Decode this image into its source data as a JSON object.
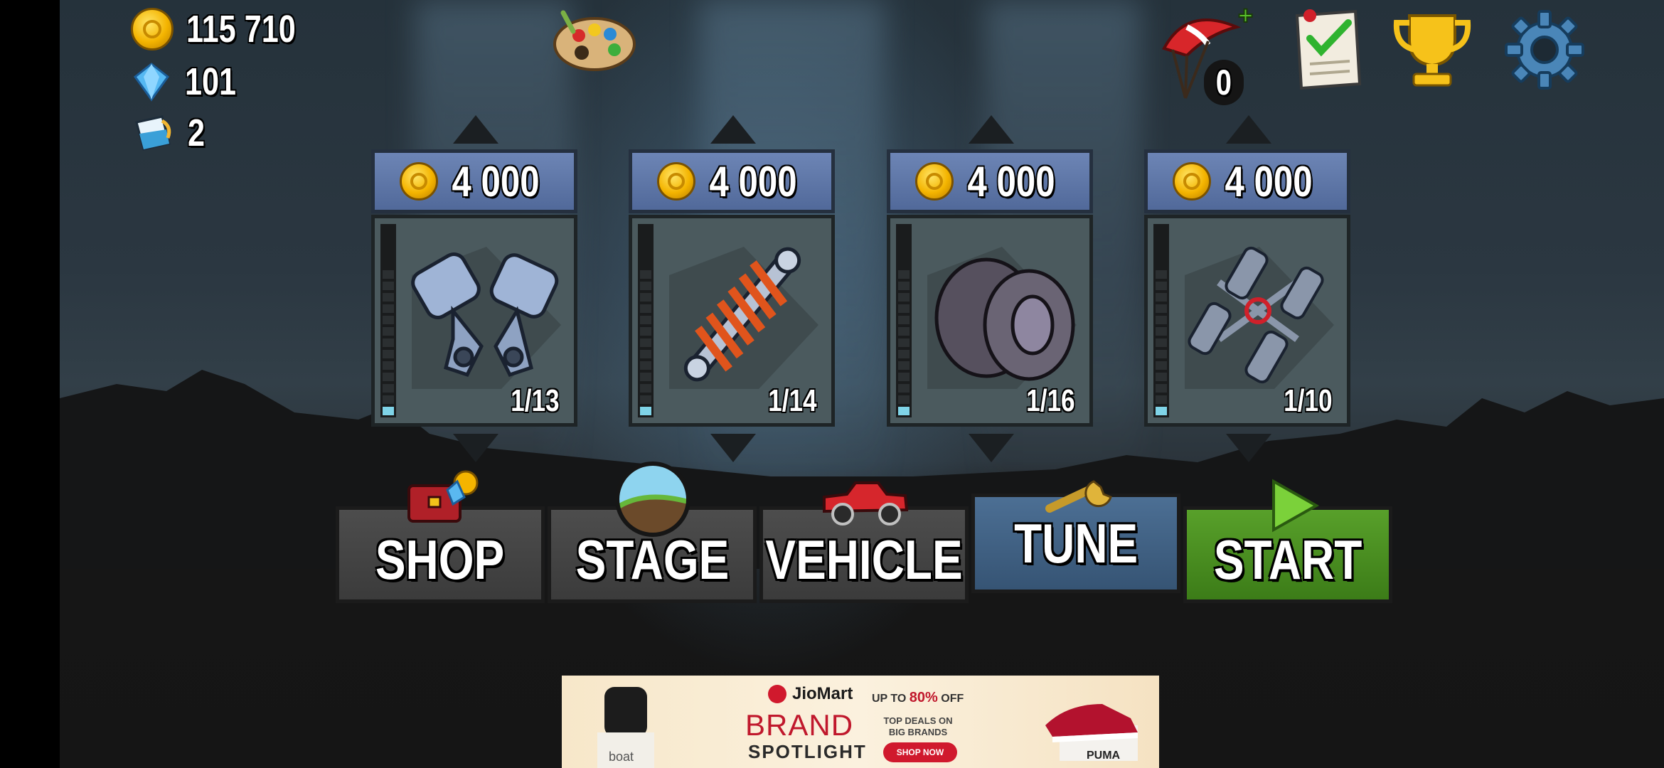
{
  "currency": {
    "coins": "115 710",
    "gems": "101",
    "paint": "2"
  },
  "top_right": {
    "parachute_count": "0"
  },
  "upgrades": [
    {
      "name": "engine",
      "price": "4 000",
      "level": "1/13"
    },
    {
      "name": "suspension",
      "price": "4 000",
      "level": "1/14"
    },
    {
      "name": "tires",
      "price": "4 000",
      "level": "1/16"
    },
    {
      "name": "4wd",
      "price": "4 000",
      "level": "1/10"
    }
  ],
  "nav": {
    "shop": "SHOP",
    "stage": "STAGE",
    "vehicle": "VEHICLE",
    "tune": "TUNE",
    "start": "START"
  },
  "ad": {
    "logo": "JioMart",
    "headline": "BRAND",
    "subheadline": "SPOTLIGHT",
    "offer_prefix": "UP TO",
    "offer_value": "80%",
    "offer_suffix": "OFF",
    "deals": "TOP DEALS ON BIG BRANDS",
    "cta": "SHOP NOW",
    "left_brand": "boat",
    "right_brand": "PUMA"
  },
  "colors": {
    "tune_active": "#4c6f94",
    "start_green": "#58a02a",
    "price_blue": "#6d85b5",
    "meter_fill": "#7fd4e8"
  }
}
